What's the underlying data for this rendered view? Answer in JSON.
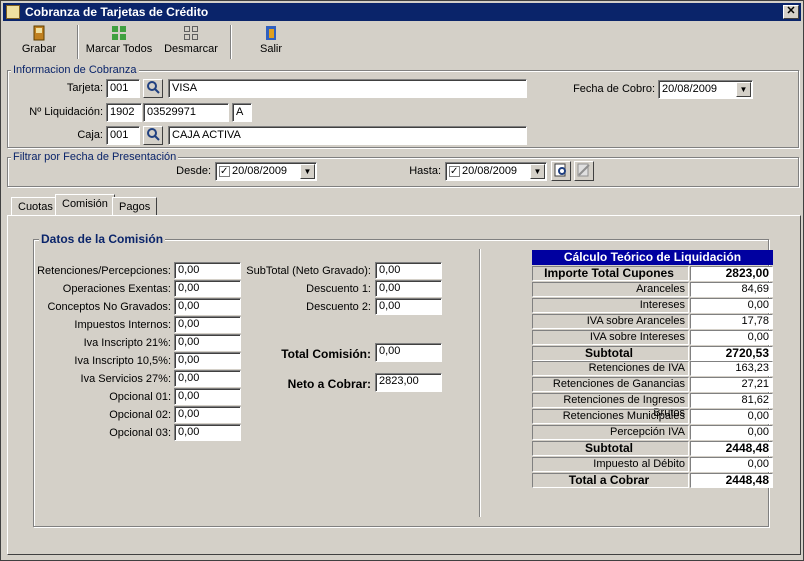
{
  "window": {
    "title": "Cobranza de Tarjetas de Crédito",
    "close": "✕"
  },
  "toolbar": {
    "grabar": "Grabar",
    "marcar_todos": "Marcar Todos",
    "desmarcar": "Desmarcar",
    "salir": "Salir"
  },
  "cobranza": {
    "group_label": "Informacion de Cobranza",
    "tarjeta_label": "Tarjeta:",
    "tarjeta_code": "001",
    "tarjeta_name": "VISA",
    "liquidacion_label": "Nº Liquidación:",
    "liquidacion_1": "1902",
    "liquidacion_2": "03529971",
    "liquidacion_3": "A",
    "caja_label": "Caja:",
    "caja_code": "001",
    "caja_name": "CAJA ACTIVA",
    "fecha_cobro_label": "Fecha de Cobro:",
    "fecha_cobro": "20/08/2009"
  },
  "filtro": {
    "group_label": "Filtrar por Fecha de Presentación",
    "desde_label": "Desde:",
    "desde": "20/08/2009",
    "hasta_label": "Hasta:",
    "hasta": "20/08/2009"
  },
  "tabs": [
    "Cuotas",
    "Comisión",
    "Pagos"
  ],
  "comision": {
    "group_label": "Datos de la Comisión",
    "left": [
      {
        "label": "Retenciones/Percepciones:",
        "value": "0,00"
      },
      {
        "label": "Operaciones Exentas:",
        "value": "0,00"
      },
      {
        "label": "Conceptos No Gravados:",
        "value": "0,00"
      },
      {
        "label": "Impuestos Internos:",
        "value": "0,00"
      },
      {
        "label": "Iva Inscripto 21%:",
        "value": "0,00"
      },
      {
        "label": "Iva Inscripto 10,5%:",
        "value": "0,00"
      },
      {
        "label": "Iva Servicios 27%:",
        "value": "0,00"
      },
      {
        "label": "Opcional 01:",
        "value": "0,00"
      },
      {
        "label": "Opcional 02:",
        "value": "0,00"
      },
      {
        "label": "Opcional 03:",
        "value": "0,00"
      }
    ],
    "right": [
      {
        "label": "SubTotal (Neto Gravado):",
        "value": "0,00"
      },
      {
        "label": "Descuento 1:",
        "value": "0,00"
      },
      {
        "label": "Descuento 2:",
        "value": "0,00"
      }
    ],
    "total_comision_label": "Total Comisión:",
    "total_comision": "0,00",
    "neto_cobrar_label": "Neto a Cobrar:",
    "neto_cobrar": "2823,00"
  },
  "calculo": {
    "title": "Cálculo Teórico de Liquidación",
    "rows": [
      {
        "label": "Importe Total Cupones",
        "value": "2823,00",
        "bold": true
      },
      {
        "label": "Aranceles",
        "value": "84,69"
      },
      {
        "label": "Intereses",
        "value": "0,00"
      },
      {
        "label": "IVA sobre Aranceles",
        "value": "17,78"
      },
      {
        "label": "IVA sobre Intereses",
        "value": "0,00"
      },
      {
        "label": "Subtotal",
        "value": "2720,53",
        "bold": true
      },
      {
        "label": "Retenciones de IVA",
        "value": "163,23"
      },
      {
        "label": "Retenciones de Ganancias",
        "value": "27,21"
      },
      {
        "label": "Retenciones de Ingresos Brutos",
        "value": "81,62"
      },
      {
        "label": "Retenciones Municipales",
        "value": "0,00"
      },
      {
        "label": "Percepción IVA",
        "value": "0,00"
      },
      {
        "label": "Subtotal",
        "value": "2448,48",
        "bold": true
      },
      {
        "label": "Impuesto al Débito",
        "value": "0,00"
      },
      {
        "label": "Total a Cobrar",
        "value": "2448,48",
        "bold": true
      }
    ]
  }
}
